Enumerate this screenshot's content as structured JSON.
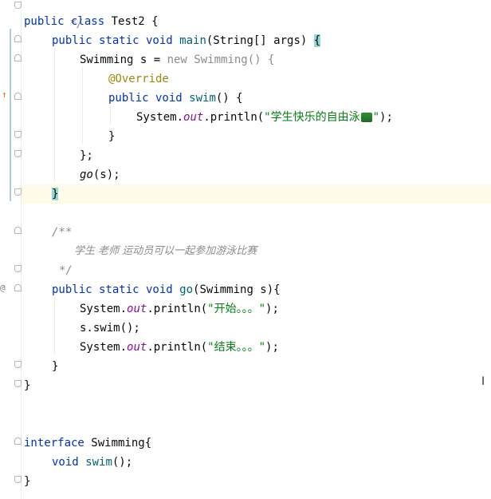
{
  "editor": {
    "lines": {
      "l0": "*/",
      "l1_kw": "public class",
      "l1_rest": " Test2 {",
      "l2_kw": "public static void",
      "l2_fn": "main",
      "l2_rest": "(String[] args) ",
      "l2_brace": "{",
      "l3_pre": "Swimming s = ",
      "l3_new": "new",
      "l3_cls": " Swimming() {",
      "l4_ann": "@Override",
      "l5_kw": "public void",
      "l5_fn": "swim",
      "l5_rest": "() {",
      "l6_pre": "System.",
      "l6_out": "out",
      "l6_mid": ".println(",
      "l6_str": "\"学生快乐的自由泳",
      "l6_str_end": "\"",
      "l6_end": ");",
      "l7": "}",
      "l8": "};",
      "l9_fn": "go",
      "l9_rest": "(s);",
      "l10_brace": "}",
      "l12_cmt": "/**",
      "l13_cmt": "学生 老师 运动员可以一起参加游泳比赛",
      "l14_cmt": "*/",
      "l15_kw": "public static void",
      "l15_fn": "go",
      "l15_rest": "(Swimming s){",
      "l16_pre": "System.",
      "l16_out": "out",
      "l16_mid": ".println(",
      "l16_str": "\"开始。。。\"",
      "l16_end": ");",
      "l17": "s.swim();",
      "l18_pre": "System.",
      "l18_out": "out",
      "l18_mid": ".println(",
      "l18_str": "\"结束。。。\"",
      "l18_end": ");",
      "l19": "}",
      "l20": "}",
      "l23_kw": "interface",
      "l23_rest": " Swimming{",
      "l24_kw": "void",
      "l24_fn": "swim",
      "l24_rest": "();",
      "l25": "}"
    },
    "gutter": {
      "override_marker": "↑",
      "implemented_marker": "@"
    },
    "cursor_glyph": "I"
  },
  "colors": {
    "keyword": "#0033b3",
    "function": "#00627a",
    "string": "#067d17",
    "annotation": "#9e880d",
    "static_field": "#871094",
    "comment": "#8c8c8c",
    "current_line": "#fefbe8",
    "brace_match": "#93d9d9"
  }
}
